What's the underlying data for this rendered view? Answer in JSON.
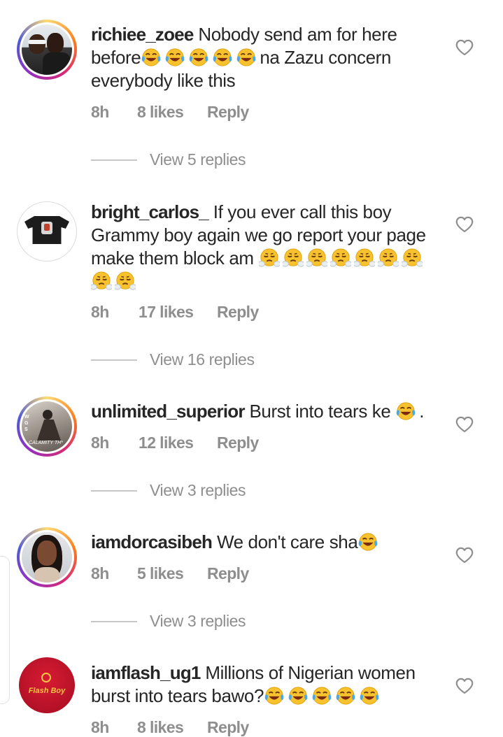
{
  "comments": [
    {
      "username": "richiee_zoee",
      "text_part1": " Nobody send am for here before",
      "text_part2": "na Zazu concern everybody like this",
      "emoji_1": "laughing-tears",
      "time": "8h",
      "likes": "8 likes",
      "reply": "Reply",
      "view_replies": "View 5 replies"
    },
    {
      "username": "bright_carlos_",
      "text_part1": " If you ever call this boy Grammy boy again we go report your page make them block am ",
      "emoji_1": "steam-from-nose",
      "time": "8h",
      "likes": "17 likes",
      "reply": "Reply",
      "view_replies": "View 16 replies"
    },
    {
      "username": "unlimited_superior",
      "text_part1": " Burst into tears ke ",
      "text_part2": ".",
      "emoji_1": "laughing-tears",
      "avatar_caption": "CALAMITY TH*",
      "avatar_side_text": "W G S",
      "time": "8h",
      "likes": "12 likes",
      "reply": "Reply",
      "view_replies": "View 3 replies"
    },
    {
      "username": "iamdorcasibeh",
      "text_part1": " We don't care sha",
      "emoji_1": "laughing-tears",
      "time": "8h",
      "likes": "5 likes",
      "reply": "Reply",
      "view_replies": "View 3 replies"
    },
    {
      "username": "iamflash_ug1",
      "text_part1": " Millions of Nigerian women burst into  tears bawo?",
      "emoji_1": "laughing-tears",
      "avatar_logo_text": "Flash Boy",
      "time": "8h",
      "likes": "8 likes",
      "reply": "Reply"
    }
  ],
  "colors": {
    "username": "#262626",
    "meta": "#8e8e8e",
    "emoji_face": "#f7c22e",
    "flash_red": "#c8102e"
  }
}
